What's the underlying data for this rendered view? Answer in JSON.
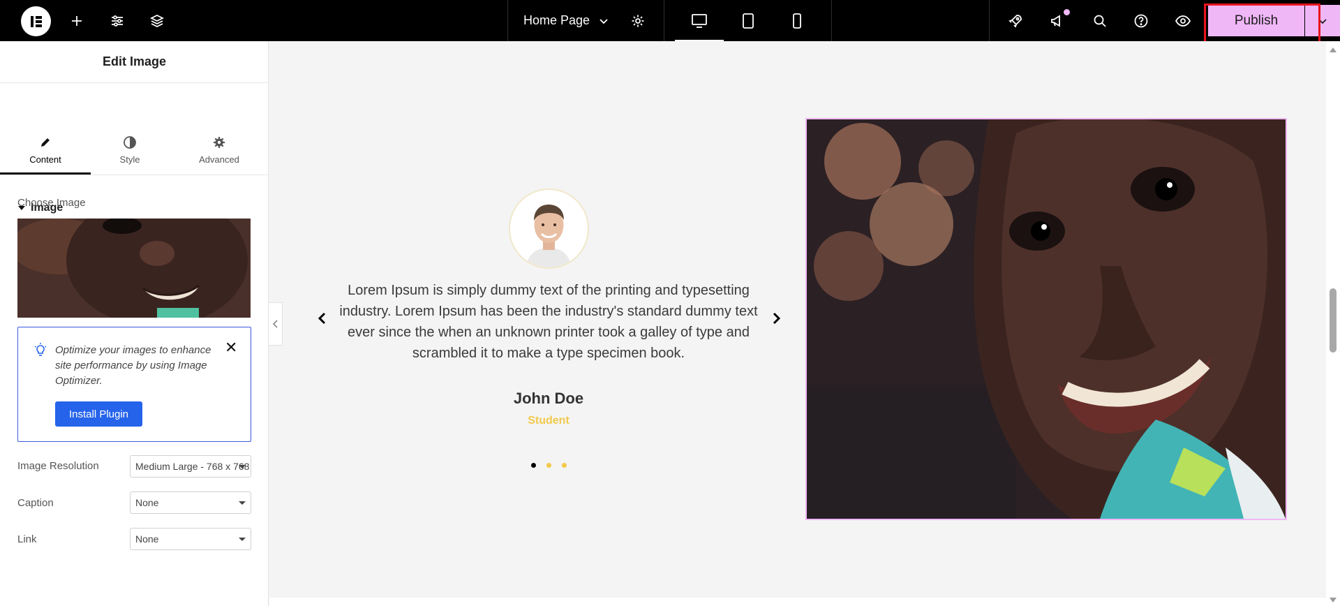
{
  "topbar": {
    "page_name": "Home Page",
    "publish_label": "Publish"
  },
  "panel": {
    "title": "Edit Image",
    "tabs": [
      {
        "label": "Content"
      },
      {
        "label": "Style"
      },
      {
        "label": "Advanced"
      }
    ],
    "section_title": "Image",
    "choose_image_label": "Choose Image",
    "notice": {
      "text": "Optimize your images to enhance site performance by using Image Optimizer.",
      "button": "Install Plugin"
    },
    "fields": [
      {
        "label": "Image Resolution",
        "value": "Medium Large - 768 x 768"
      },
      {
        "label": "Caption",
        "value": "None"
      },
      {
        "label": "Link",
        "value": "None"
      }
    ]
  },
  "testimonial": {
    "quote": "Lorem Ipsum is simply dummy text of the printing and typesetting industry. Lorem Ipsum has been the industry's standard dummy text ever since the when an unknown printer took a galley of type and scrambled it to make a type specimen book.",
    "name": "John Doe",
    "role": "Student"
  },
  "colors": {
    "accent": "#f0b7f7",
    "highlight": "#e8141c",
    "role": "#f2c94c",
    "install_button": "#2563eb"
  }
}
